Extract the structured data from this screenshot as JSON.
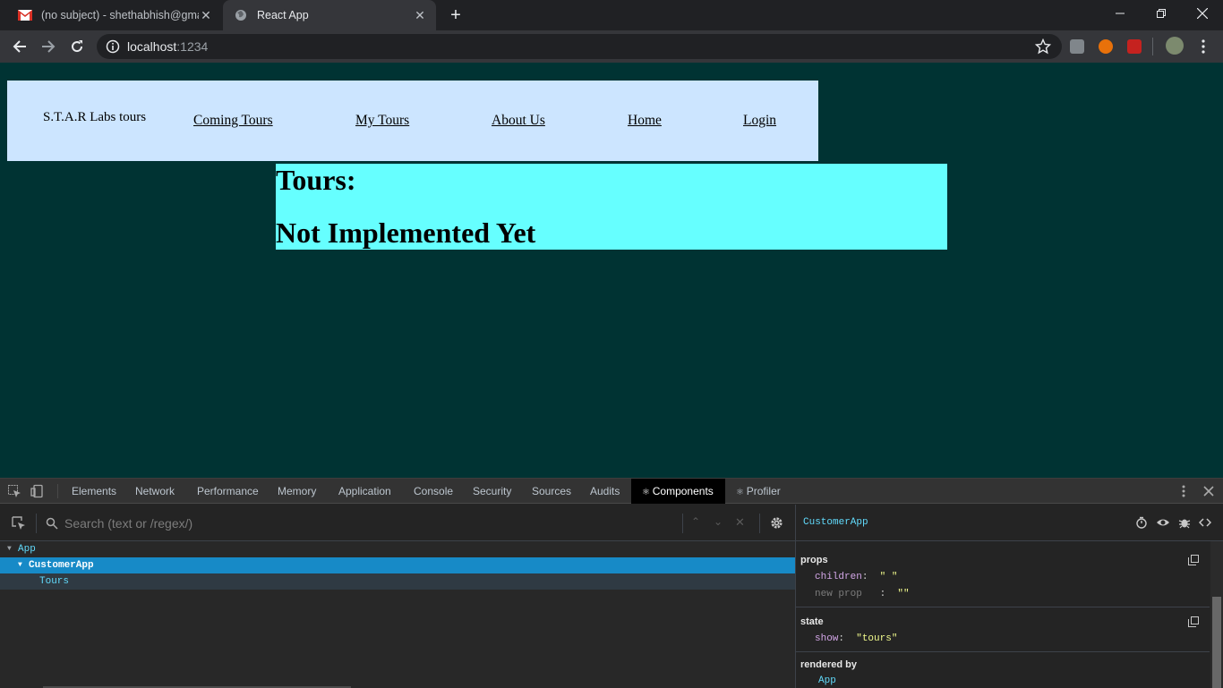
{
  "browser": {
    "tabs": [
      {
        "title": "(no subject) - shethabhish@gmail.com - Gmail",
        "favicon": "gmail-icon",
        "active": false
      },
      {
        "title": "React App",
        "favicon": "globe-icon",
        "active": true
      }
    ],
    "new_tab_symbol": "+",
    "window_controls": {
      "minimize": "—",
      "restore": "❐",
      "close": "✕"
    },
    "address": {
      "host": "localhost",
      "port": ":1234"
    }
  },
  "app": {
    "brand": "S.T.A.R Labs tours",
    "nav": [
      "Coming Tours",
      "My Tours",
      "About Us",
      "Home",
      "Login"
    ],
    "tours_heading": "Tours:",
    "tours_message": "Not Implemented Yet",
    "colors": {
      "page_bg": "#003333",
      "navbar_bg": "#cce5ff",
      "tours_bg": "#66ffff"
    }
  },
  "devtools": {
    "tabs": [
      "Elements",
      "Network",
      "Performance",
      "Memory",
      "Application",
      "Console",
      "Security",
      "Sources",
      "Audits",
      "Components",
      "Profiler"
    ],
    "active_tab": "Components",
    "search_placeholder": "Search (text or /regex/)",
    "tree": [
      {
        "name": "App",
        "depth": 0,
        "expanded": true,
        "selected": false
      },
      {
        "name": "CustomerApp",
        "depth": 1,
        "expanded": true,
        "selected": true
      },
      {
        "name": "Tours",
        "depth": 2,
        "expanded": false,
        "selected": false
      }
    ],
    "inspector": {
      "component": "CustomerApp",
      "props_title": "props",
      "props": [
        {
          "key": "children",
          "value": "\" \""
        },
        {
          "key": "new prop",
          "value": "\"\""
        }
      ],
      "state_title": "state",
      "state": [
        {
          "key": "show",
          "value": "\"tours\""
        }
      ],
      "rendered_by_title": "rendered by",
      "rendered_by": "App"
    }
  }
}
